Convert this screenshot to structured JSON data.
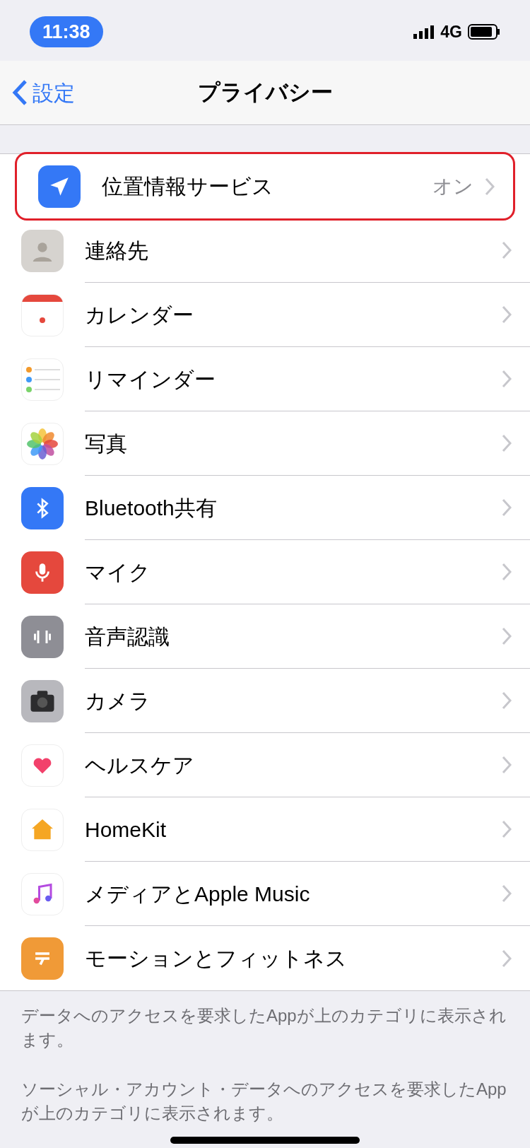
{
  "status_bar": {
    "time": "11:38",
    "network": "4G"
  },
  "nav": {
    "back": "設定",
    "title": "プライバシー"
  },
  "items": [
    {
      "label": "位置情報サービス",
      "value": "オン",
      "highlighted": true
    },
    {
      "label": "連絡先",
      "highlighted": false
    },
    {
      "label": "カレンダー",
      "highlighted": false
    },
    {
      "label": "リマインダー",
      "highlighted": false
    },
    {
      "label": "写真",
      "highlighted": false
    },
    {
      "label": "Bluetooth共有",
      "highlighted": false
    },
    {
      "label": "マイク",
      "highlighted": false
    },
    {
      "label": "音声認識",
      "highlighted": false
    },
    {
      "label": "カメラ",
      "highlighted": false
    },
    {
      "label": "ヘルスケア",
      "highlighted": false
    },
    {
      "label": "HomeKit",
      "highlighted": false
    },
    {
      "label": "メディアとApple Music",
      "highlighted": false
    },
    {
      "label": "モーションとフィットネス",
      "highlighted": false
    }
  ],
  "footer_notes": [
    "データへのアクセスを要求したAppが上のカテゴリに表示されます。",
    "ソーシャル・アカウント・データへのアクセスを要求したAppが上のカテゴリに表示されます。"
  ]
}
